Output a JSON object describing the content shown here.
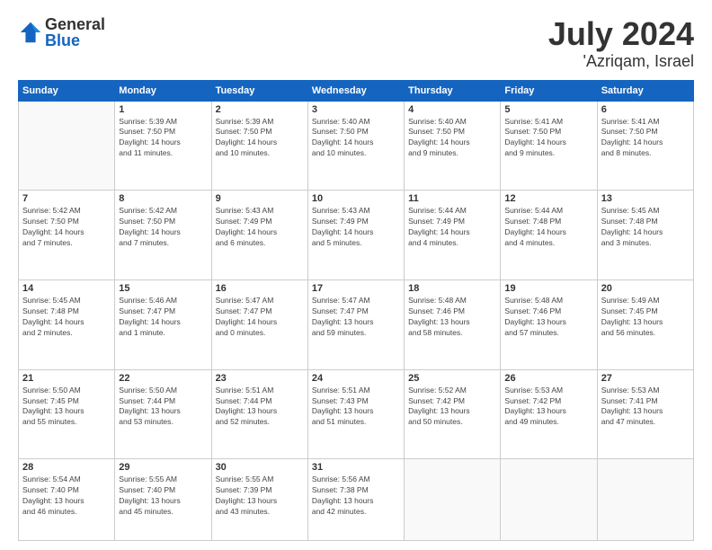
{
  "header": {
    "logo_general": "General",
    "logo_blue": "Blue",
    "month_year": "July 2024",
    "location": "'Azriqam, Israel"
  },
  "weekdays": [
    "Sunday",
    "Monday",
    "Tuesday",
    "Wednesday",
    "Thursday",
    "Friday",
    "Saturday"
  ],
  "weeks": [
    [
      {
        "day": "",
        "info": ""
      },
      {
        "day": "1",
        "info": "Sunrise: 5:39 AM\nSunset: 7:50 PM\nDaylight: 14 hours\nand 11 minutes."
      },
      {
        "day": "2",
        "info": "Sunrise: 5:39 AM\nSunset: 7:50 PM\nDaylight: 14 hours\nand 10 minutes."
      },
      {
        "day": "3",
        "info": "Sunrise: 5:40 AM\nSunset: 7:50 PM\nDaylight: 14 hours\nand 10 minutes."
      },
      {
        "day": "4",
        "info": "Sunrise: 5:40 AM\nSunset: 7:50 PM\nDaylight: 14 hours\nand 9 minutes."
      },
      {
        "day": "5",
        "info": "Sunrise: 5:41 AM\nSunset: 7:50 PM\nDaylight: 14 hours\nand 9 minutes."
      },
      {
        "day": "6",
        "info": "Sunrise: 5:41 AM\nSunset: 7:50 PM\nDaylight: 14 hours\nand 8 minutes."
      }
    ],
    [
      {
        "day": "7",
        "info": "Sunrise: 5:42 AM\nSunset: 7:50 PM\nDaylight: 14 hours\nand 7 minutes."
      },
      {
        "day": "8",
        "info": "Sunrise: 5:42 AM\nSunset: 7:50 PM\nDaylight: 14 hours\nand 7 minutes."
      },
      {
        "day": "9",
        "info": "Sunrise: 5:43 AM\nSunset: 7:49 PM\nDaylight: 14 hours\nand 6 minutes."
      },
      {
        "day": "10",
        "info": "Sunrise: 5:43 AM\nSunset: 7:49 PM\nDaylight: 14 hours\nand 5 minutes."
      },
      {
        "day": "11",
        "info": "Sunrise: 5:44 AM\nSunset: 7:49 PM\nDaylight: 14 hours\nand 4 minutes."
      },
      {
        "day": "12",
        "info": "Sunrise: 5:44 AM\nSunset: 7:48 PM\nDaylight: 14 hours\nand 4 minutes."
      },
      {
        "day": "13",
        "info": "Sunrise: 5:45 AM\nSunset: 7:48 PM\nDaylight: 14 hours\nand 3 minutes."
      }
    ],
    [
      {
        "day": "14",
        "info": "Sunrise: 5:45 AM\nSunset: 7:48 PM\nDaylight: 14 hours\nand 2 minutes."
      },
      {
        "day": "15",
        "info": "Sunrise: 5:46 AM\nSunset: 7:47 PM\nDaylight: 14 hours\nand 1 minute."
      },
      {
        "day": "16",
        "info": "Sunrise: 5:47 AM\nSunset: 7:47 PM\nDaylight: 14 hours\nand 0 minutes."
      },
      {
        "day": "17",
        "info": "Sunrise: 5:47 AM\nSunset: 7:47 PM\nDaylight: 13 hours\nand 59 minutes."
      },
      {
        "day": "18",
        "info": "Sunrise: 5:48 AM\nSunset: 7:46 PM\nDaylight: 13 hours\nand 58 minutes."
      },
      {
        "day": "19",
        "info": "Sunrise: 5:48 AM\nSunset: 7:46 PM\nDaylight: 13 hours\nand 57 minutes."
      },
      {
        "day": "20",
        "info": "Sunrise: 5:49 AM\nSunset: 7:45 PM\nDaylight: 13 hours\nand 56 minutes."
      }
    ],
    [
      {
        "day": "21",
        "info": "Sunrise: 5:50 AM\nSunset: 7:45 PM\nDaylight: 13 hours\nand 55 minutes."
      },
      {
        "day": "22",
        "info": "Sunrise: 5:50 AM\nSunset: 7:44 PM\nDaylight: 13 hours\nand 53 minutes."
      },
      {
        "day": "23",
        "info": "Sunrise: 5:51 AM\nSunset: 7:44 PM\nDaylight: 13 hours\nand 52 minutes."
      },
      {
        "day": "24",
        "info": "Sunrise: 5:51 AM\nSunset: 7:43 PM\nDaylight: 13 hours\nand 51 minutes."
      },
      {
        "day": "25",
        "info": "Sunrise: 5:52 AM\nSunset: 7:42 PM\nDaylight: 13 hours\nand 50 minutes."
      },
      {
        "day": "26",
        "info": "Sunrise: 5:53 AM\nSunset: 7:42 PM\nDaylight: 13 hours\nand 49 minutes."
      },
      {
        "day": "27",
        "info": "Sunrise: 5:53 AM\nSunset: 7:41 PM\nDaylight: 13 hours\nand 47 minutes."
      }
    ],
    [
      {
        "day": "28",
        "info": "Sunrise: 5:54 AM\nSunset: 7:40 PM\nDaylight: 13 hours\nand 46 minutes."
      },
      {
        "day": "29",
        "info": "Sunrise: 5:55 AM\nSunset: 7:40 PM\nDaylight: 13 hours\nand 45 minutes."
      },
      {
        "day": "30",
        "info": "Sunrise: 5:55 AM\nSunset: 7:39 PM\nDaylight: 13 hours\nand 43 minutes."
      },
      {
        "day": "31",
        "info": "Sunrise: 5:56 AM\nSunset: 7:38 PM\nDaylight: 13 hours\nand 42 minutes."
      },
      {
        "day": "",
        "info": ""
      },
      {
        "day": "",
        "info": ""
      },
      {
        "day": "",
        "info": ""
      }
    ]
  ]
}
